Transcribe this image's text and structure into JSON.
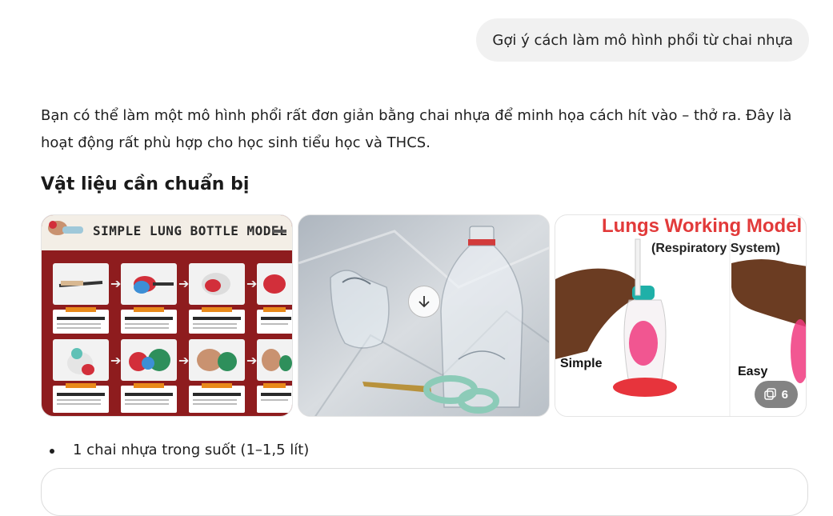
{
  "user_message": "Gợi ý cách làm mô hình phổi từ chai nhựa",
  "response": {
    "intro": "Bạn có thể làm một mô hình phổi rất đơn giản bằng chai nhựa để minh họa cách hít vào – thở ra. Đây là hoạt động rất phù hợp cho học sinh tiểu học và THCS.",
    "section_title": "Vật liệu cần chuẩn bị",
    "gallery": {
      "image1_title": "SIMPLE LUNG BOTTLE MODEL",
      "image3_title": "Lungs Working Model",
      "image3_subtitle": "(Respiratory System)",
      "image3_label_left": "Simple",
      "image3_label_right": "Easy",
      "more_count": "6"
    },
    "materials": [
      "1 chai nhựa trong suốt (1–1,5 lít)"
    ]
  },
  "icons": {
    "download": "download-arrow-icon",
    "gallery": "image-stack-icon"
  },
  "colors": {
    "bubble": "#f1f1f1",
    "poster_red": "#8e1c1e",
    "accent_red": "#e23a3a"
  }
}
